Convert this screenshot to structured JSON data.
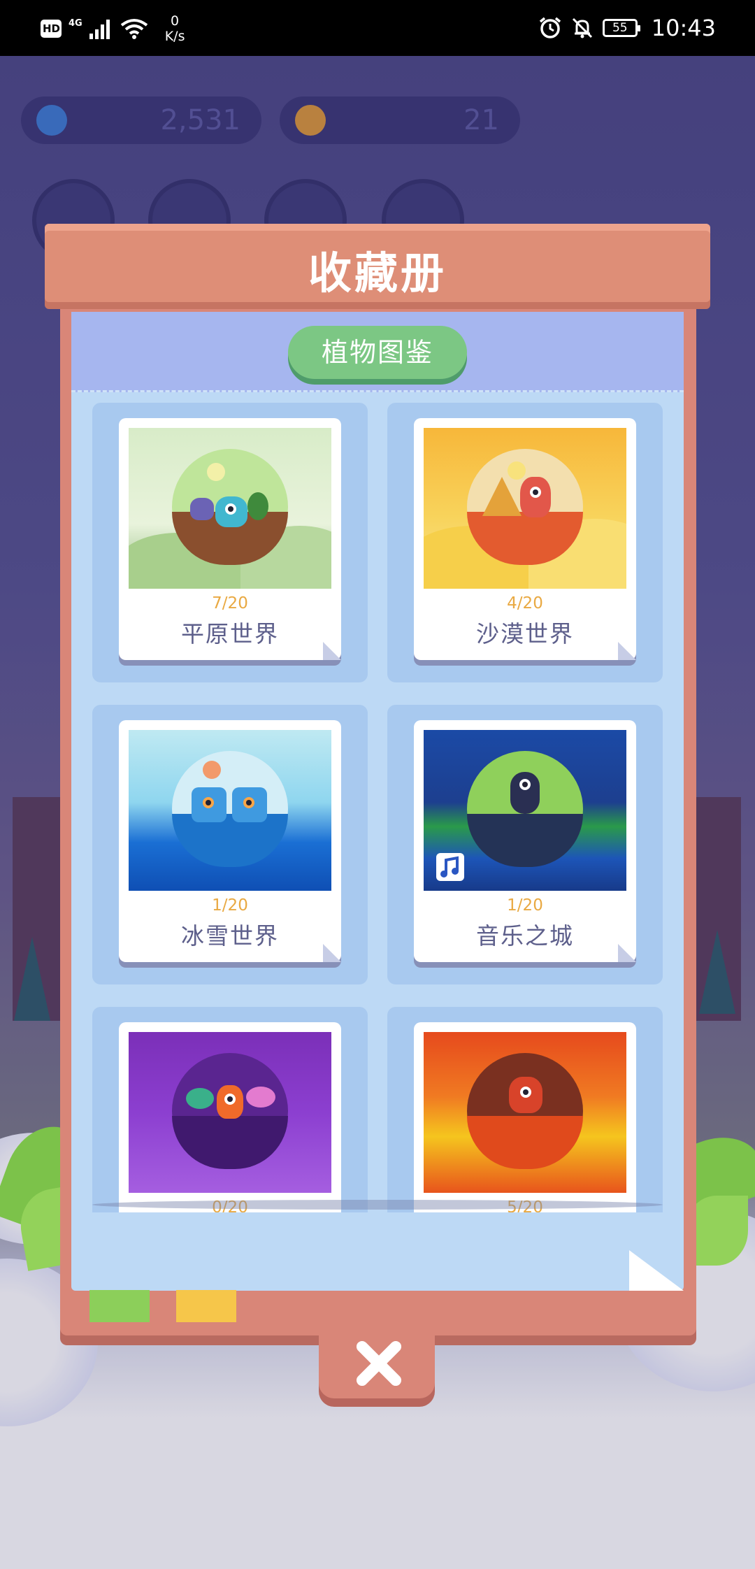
{
  "status_bar": {
    "hd_badge": "HD",
    "network": "4G",
    "speed_value": "0",
    "speed_unit": "K/s",
    "battery": "55",
    "time": "10:43",
    "icons": [
      "signal-icon",
      "wifi-icon",
      "alarm-icon",
      "mute-icon",
      "battery-icon"
    ]
  },
  "background": {
    "water_count": "2,531",
    "sun_count": "21",
    "icons": [
      "water-drop-icon",
      "sun-icon",
      "settings-icon",
      "book-icon",
      "notes-icon",
      "video-icon"
    ]
  },
  "album": {
    "title": "收藏册",
    "tab_label": "植物图鉴",
    "worlds": [
      {
        "progress": "7/20",
        "name": "平原世界",
        "theme": "plains"
      },
      {
        "progress": "4/20",
        "name": "沙漠世界",
        "theme": "desert"
      },
      {
        "progress": "1/20",
        "name": "冰雪世界",
        "theme": "ice"
      },
      {
        "progress": "1/20",
        "name": "音乐之城",
        "theme": "music"
      },
      {
        "progress": "0/20",
        "name": "",
        "theme": "purple"
      },
      {
        "progress": "5/20",
        "name": "",
        "theme": "lava"
      }
    ],
    "close_icon": "close-icon"
  },
  "colors": {
    "frame": "#d98678",
    "paper": "#bdd9f5",
    "tab_green": "#7cc784",
    "progress_text": "#e9a942",
    "name_text": "#5d5f8b"
  }
}
